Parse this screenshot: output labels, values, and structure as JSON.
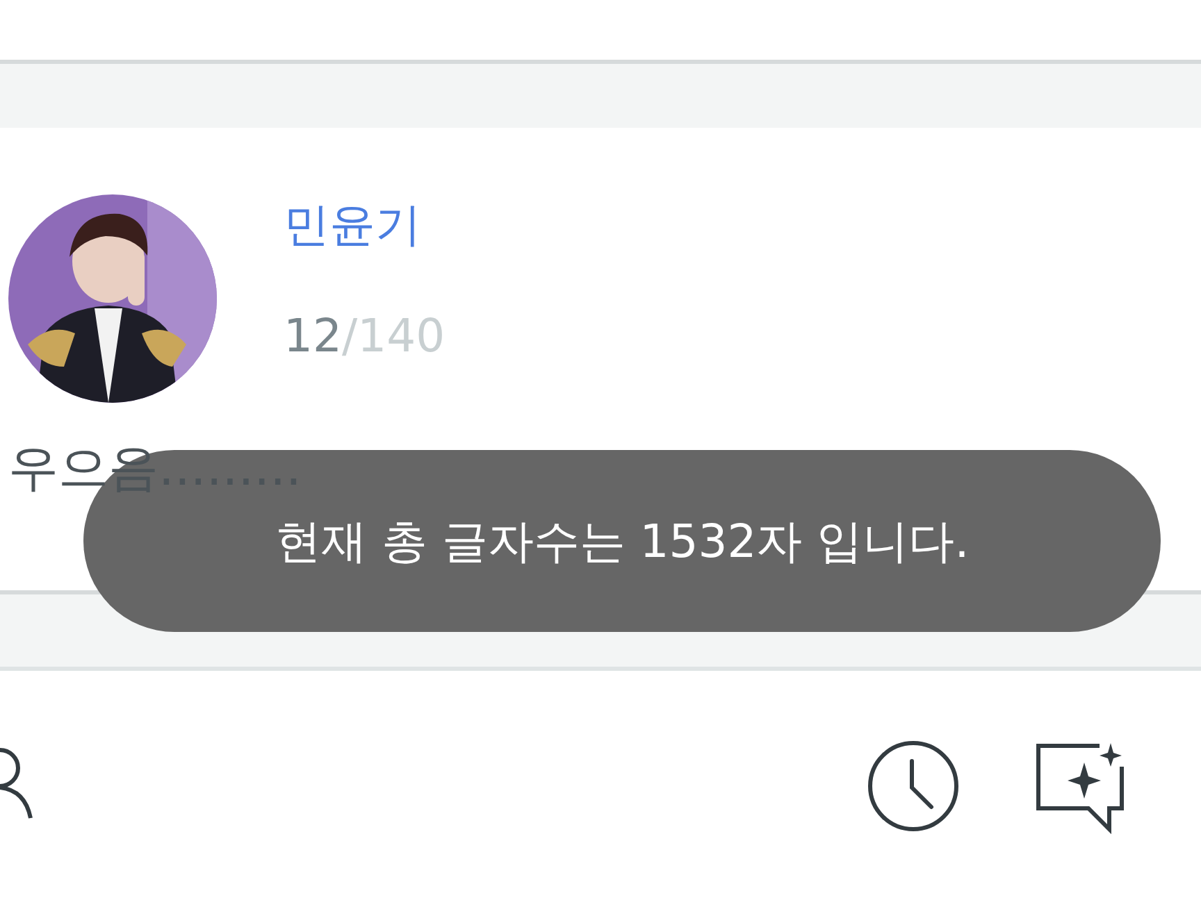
{
  "post": {
    "author": "민윤기",
    "count": "12",
    "limit": "/140",
    "text": "우으음........."
  },
  "toast": {
    "message": "현재 총 글자수는 1532자 입니다."
  }
}
